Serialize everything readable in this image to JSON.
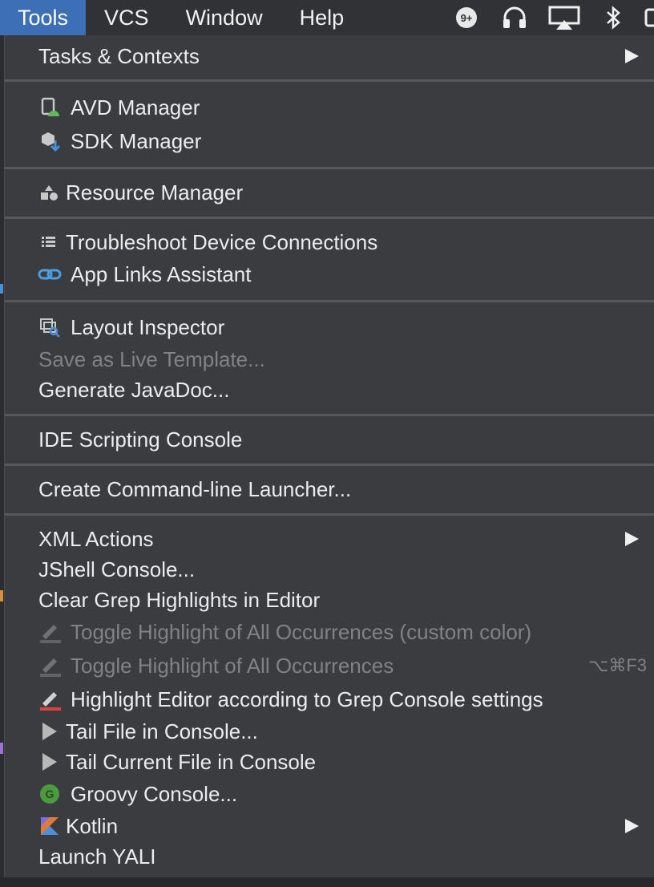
{
  "menubar": {
    "items": [
      "Tools",
      "VCS",
      "Window",
      "Help"
    ],
    "active": "Tools",
    "notification_badge": "9+"
  },
  "menu": {
    "tasks_contexts": "Tasks & Contexts",
    "avd_manager": "AVD Manager",
    "sdk_manager": "SDK Manager",
    "resource_manager": "Resource Manager",
    "troubleshoot": "Troubleshoot Device Connections",
    "app_links": "App Links Assistant",
    "layout_inspector": "Layout Inspector",
    "save_live_template": "Save as Live Template...",
    "generate_javadoc": "Generate JavaDoc...",
    "ide_scripting": "IDE Scripting Console",
    "command_line_launcher": "Create Command-line Launcher...",
    "xml_actions": "XML Actions",
    "jshell": "JShell Console...",
    "clear_grep": "Clear Grep Highlights in Editor",
    "toggle_custom": "Toggle Highlight of All Occurrences (custom color)",
    "toggle_all": "Toggle Highlight of All Occurrences",
    "toggle_all_shortcut": "⌥⌘F3",
    "highlight_grep": "Highlight Editor according to Grep Console settings",
    "tail_file": "Tail File in Console...",
    "tail_current": "Tail Current File in Console",
    "groovy": "Groovy Console...",
    "kotlin": "Kotlin",
    "launch_yali": "Launch YALI"
  },
  "colors": {
    "menu_bg": "#3a3c40",
    "active_menu": "#3d6fb6",
    "disabled_text": "#808286",
    "separator": "#56585c"
  }
}
